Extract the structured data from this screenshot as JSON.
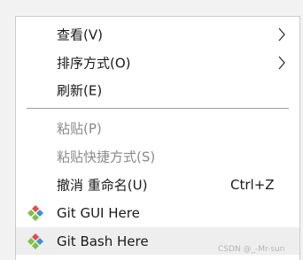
{
  "menu": {
    "items": [
      {
        "label": "查看(V)"
      },
      {
        "label": "排序方式(O)"
      },
      {
        "label": "刷新(E)"
      },
      {
        "label": "粘贴(P)"
      },
      {
        "label": "粘贴快捷方式(S)"
      },
      {
        "label": "撤消 重命名(U)",
        "shortcut": "Ctrl+Z"
      },
      {
        "label": "Git GUI Here"
      },
      {
        "label": "Git Bash Here"
      }
    ]
  },
  "icons": {
    "submenu": "chevron-right-icon",
    "git": "git-diamond-icon"
  },
  "colors": {
    "menu_bg": "#ffffff",
    "hover_bg": "#eeeeee",
    "disabled_text": "#8a8a8a",
    "git_red": "#e8484a",
    "git_green": "#7cc142",
    "git_blue": "#3f8fd6"
  },
  "watermark": "CSDN @_-Mr-sun"
}
